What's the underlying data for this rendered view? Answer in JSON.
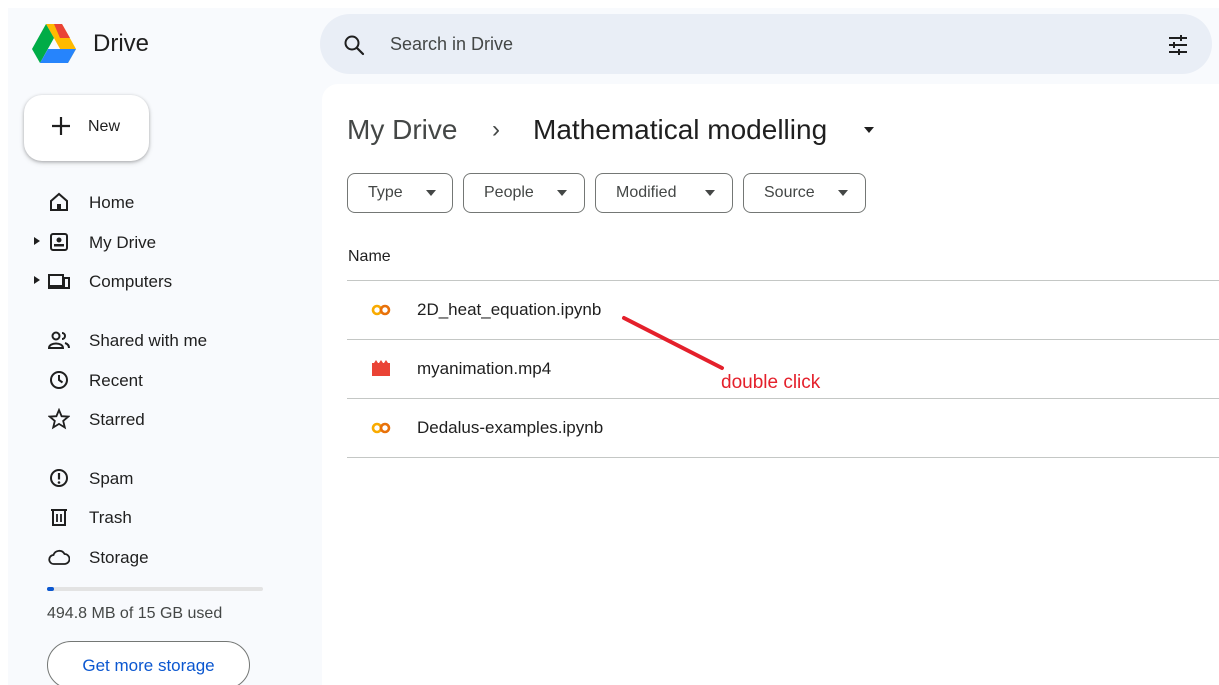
{
  "app": {
    "title": "Drive"
  },
  "search": {
    "placeholder": "Search in Drive",
    "icon": "search-icon",
    "filter_icon": "search-options-icon"
  },
  "sidebar": {
    "new_label": "New",
    "items": [
      {
        "label": "Home",
        "icon": "home-icon"
      },
      {
        "label": "My Drive",
        "icon": "my-drive-icon",
        "expandable": true
      },
      {
        "label": "Computers",
        "icon": "computers-icon",
        "expandable": true
      },
      {
        "label": "Shared with me",
        "icon": "people-icon"
      },
      {
        "label": "Recent",
        "icon": "clock-icon"
      },
      {
        "label": "Starred",
        "icon": "star-icon"
      },
      {
        "label": "Spam",
        "icon": "spam-icon"
      },
      {
        "label": "Trash",
        "icon": "trash-icon"
      },
      {
        "label": "Storage",
        "icon": "cloud-icon"
      }
    ],
    "storage": {
      "used_text": "494.8 MB of 15 GB used",
      "used_fraction": 0.032
    },
    "get_storage_label": "Get more storage"
  },
  "breadcrumb": {
    "root": "My Drive",
    "separator": "›",
    "current": "Mathematical modelling"
  },
  "filters": [
    {
      "label": "Type"
    },
    {
      "label": "People"
    },
    {
      "label": "Modified"
    },
    {
      "label": "Source"
    }
  ],
  "list": {
    "column_name": "Name",
    "files": [
      {
        "name": "2D_heat_equation.ipynb",
        "icon": "colab-icon"
      },
      {
        "name": "myanimation.mp4",
        "icon": "video-file-icon"
      },
      {
        "name": "Dedalus-examples.ipynb",
        "icon": "colab-icon"
      }
    ]
  },
  "annotation": {
    "text": "double click",
    "color": "#e4202b"
  },
  "colors": {
    "accent": "#0b57d0",
    "search_bg": "#e9eef6",
    "colab_orange": "#f9ab00",
    "video_red": "#ea4335"
  }
}
